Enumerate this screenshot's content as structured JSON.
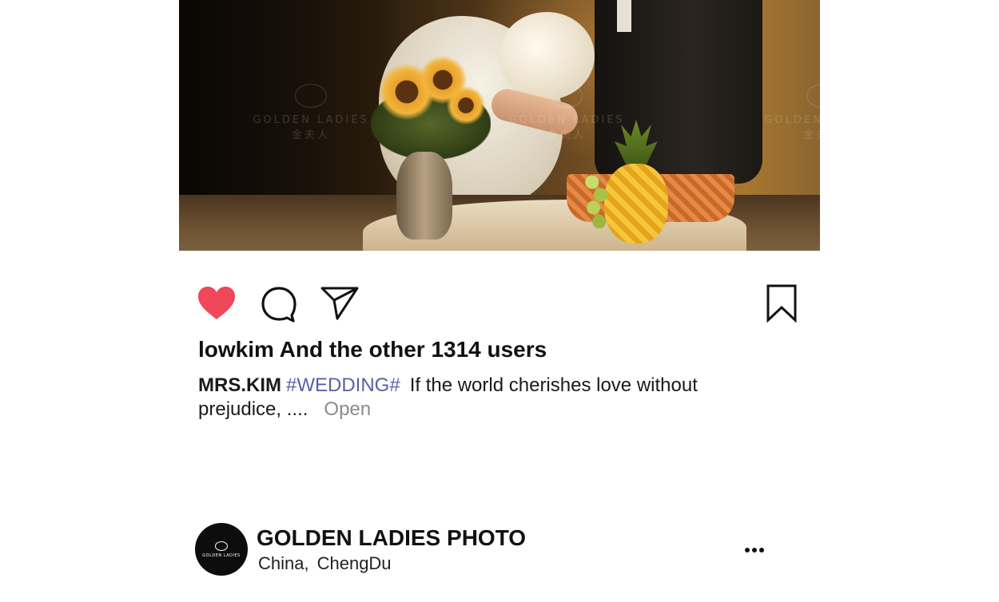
{
  "post": {
    "photo": {
      "alt": "Wedding photo: bride in white dress and groom in dark suit beside sunflowers, a pineapple and a basket",
      "watermark": {
        "brand": "GOLDEN LADIES",
        "sub": "金夫人"
      }
    },
    "actions": {
      "like": {
        "icon": "heart-icon",
        "state": "liked",
        "color": "#f0475b"
      },
      "comment": {
        "icon": "comment-icon"
      },
      "share": {
        "icon": "send-icon"
      },
      "save": {
        "icon": "bookmark-icon"
      }
    },
    "likes": {
      "user": "lowkim",
      "rest": "And the other 1314 users"
    },
    "caption": {
      "user": "MRS.KIM",
      "hashtag": "#WEDDING#",
      "text": "If the world cherishes love without prejudice, ....",
      "more": "Open",
      "hashtag_color": "#5b5fa6"
    }
  },
  "next_post": {
    "avatar_text": "GOLDEN LADIES",
    "account_name": "GOLDEN LADIES PHOTO",
    "location": {
      "country": "China,",
      "city": "ChengDu"
    },
    "more_icon": "more-horizontal-icon"
  }
}
